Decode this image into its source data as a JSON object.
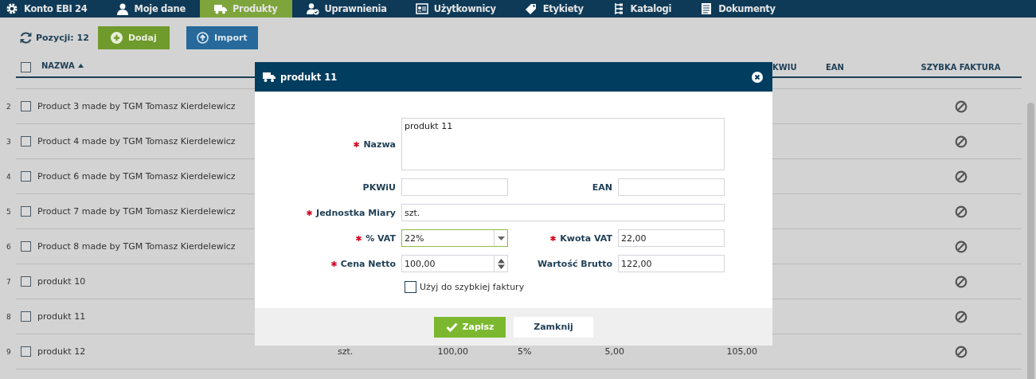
{
  "nav": [
    {
      "label": "Konto EBI 24",
      "selected": false
    },
    {
      "label": "Moje dane",
      "selected": false
    },
    {
      "label": "Produkty",
      "selected": true
    },
    {
      "label": "Uprawnienia",
      "selected": false
    },
    {
      "label": "Użytkownicy",
      "selected": false
    },
    {
      "label": "Etykiety",
      "selected": false
    },
    {
      "label": "Katalogi",
      "selected": false
    },
    {
      "label": "Dokumenty",
      "selected": false
    }
  ],
  "toolbar": {
    "count": "Pozycji: 12",
    "buttons": [
      "Dodaj",
      "Import"
    ]
  },
  "table": {
    "select_all": {
      "checked": false
    },
    "columns": [
      {
        "label": "NAZWA",
        "sorted": true
      },
      {
        "label": "KWIU"
      },
      {
        "label": "EAN"
      },
      {
        "label": "SZYBKA FAKTURA"
      }
    ],
    "rows": [
      {
        "number": "2",
        "name": "Product 3 made by TGM Tomasz Kierdelewicz",
        "checked": false,
        "quick_invoice": false
      },
      {
        "number": "3",
        "name": "Product 4 made by TGM Tomasz Kierdelewicz",
        "checked": false,
        "quick_invoice": false
      },
      {
        "number": "4",
        "name": "Product 6 made by TGM Tomasz Kierdelewicz",
        "checked": false,
        "quick_invoice": false
      },
      {
        "number": "5",
        "name": "Product 7 made by TGM Tomasz Kierdelewicz",
        "checked": false,
        "quick_invoice": false
      },
      {
        "number": "6",
        "name": "Product 8 made by TGM Tomasz Kierdelewicz",
        "checked": false,
        "quick_invoice": false
      },
      {
        "number": "7",
        "name": "produkt 10",
        "checked": false,
        "quick_invoice": false
      },
      {
        "number": "8",
        "name": "produkt 11",
        "checked": false,
        "quick_invoice": false
      },
      {
        "number": "9",
        "name": "produkt 12",
        "checked": false,
        "quick_invoice": false,
        "unit": "szt.",
        "net": "100,00",
        "vat_rate": "5%",
        "vat_amount": "5,00",
        "gross": "105,00"
      }
    ]
  },
  "modal": {
    "title": "produkt 11",
    "rows": [
      [
        {
          "kind": "textarea",
          "label": "Nazwa",
          "required": true,
          "value": "produkt 11",
          "focused": false
        }
      ],
      [
        {
          "kind": "text",
          "label": "PKWiU",
          "required": false,
          "focused": false
        },
        {
          "kind": "text",
          "label": "EAN",
          "required": false,
          "focused": false
        }
      ],
      [
        {
          "kind": "text",
          "label": "Jednostka Miary",
          "required": true,
          "value": "szt.",
          "focused": false
        }
      ],
      [
        {
          "kind": "select",
          "label": "% VAT",
          "required": true,
          "value": "22%",
          "focused": true
        },
        {
          "kind": "text",
          "label": "Kwota VAT",
          "required": true,
          "value": "22,00",
          "focused": false
        }
      ],
      [
        {
          "kind": "number",
          "label": "Cena Netto",
          "required": true,
          "value": "100,00",
          "focused": false
        },
        {
          "kind": "text",
          "label": "Wartość Brutto",
          "required": false,
          "value": "122,00",
          "focused": false
        }
      ]
    ],
    "quick_invoice": {
      "label": "Użyj do szybkiej faktury",
      "checked": false
    },
    "buttons": [
      "Zapisz",
      "Zamknij"
    ]
  }
}
